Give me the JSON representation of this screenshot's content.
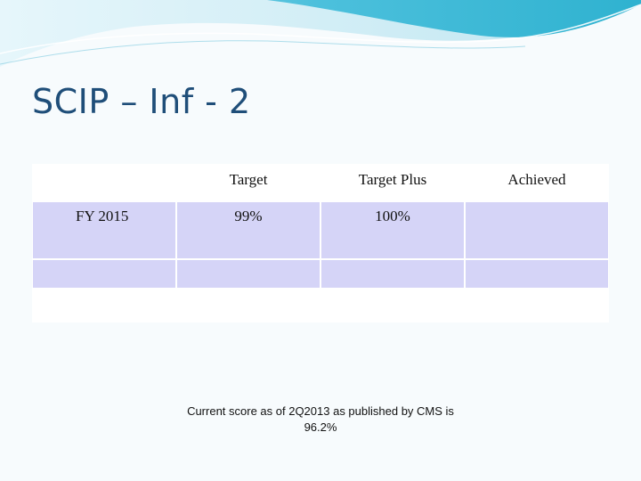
{
  "slide": {
    "title": "SCIP – Inf - 2"
  },
  "table": {
    "headers": [
      "",
      "Target",
      "Target Plus",
      "Achieved"
    ],
    "rows": [
      [
        "FY 2015",
        "99%",
        "100%",
        ""
      ],
      [
        "",
        "",
        "",
        ""
      ]
    ]
  },
  "note": {
    "text": "Current score as of 2Q2013 as published by CMS is",
    "score": "96.2%"
  },
  "colors": {
    "title": "#1f4e79",
    "cell_fill": "#d5d4f7",
    "wave_dark": "#35b7d3",
    "wave_light": "#bfe6f1"
  }
}
